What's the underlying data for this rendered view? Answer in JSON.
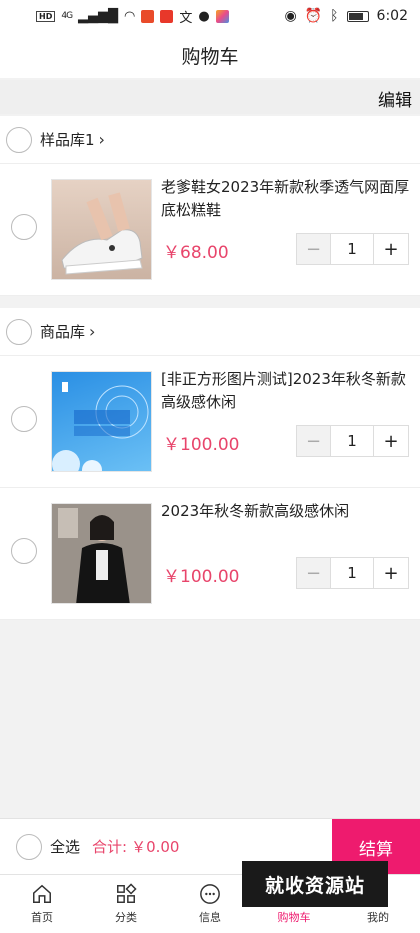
{
  "status_bar": {
    "time": "6:02",
    "network": "HD",
    "signal": "4G"
  },
  "nav": {
    "title": "购物车"
  },
  "edit_label": "编辑",
  "shops": [
    {
      "name": "样品库1",
      "items": [
        {
          "title": "老爹鞋女2023年新款秋季透气网面厚底松糕鞋",
          "price": "￥68.00",
          "quantity": "1",
          "image": "sneaker-photo"
        }
      ]
    },
    {
      "name": "商品库",
      "items": [
        {
          "title": "[非正方形图片测试]2023年秋冬新款高级感休闲",
          "price": "￥100.00",
          "quantity": "1",
          "image": "blue-banner-photo"
        },
        {
          "title": "2023年秋冬新款高级感休闲",
          "price": "￥100.00",
          "quantity": "1",
          "image": "woman-coat-photo"
        }
      ]
    }
  ],
  "stepper": {
    "minus": "−",
    "plus": "+"
  },
  "checkout": {
    "select_all": "全选",
    "total_label": "合计:",
    "total_value": "￥0.00",
    "settle_label": "结算"
  },
  "tabs": [
    {
      "label": "首页",
      "icon": "home-icon"
    },
    {
      "label": "分类",
      "icon": "category-icon"
    },
    {
      "label": "信息",
      "icon": "message-icon"
    },
    {
      "label": "购物车",
      "icon": "cart-icon"
    },
    {
      "label": "我的",
      "icon": "profile-icon"
    }
  ],
  "watermark": "就收资源站",
  "colors": {
    "accent": "#ee1b6e",
    "price": "#e8456b",
    "background": "#f2f2f2"
  }
}
